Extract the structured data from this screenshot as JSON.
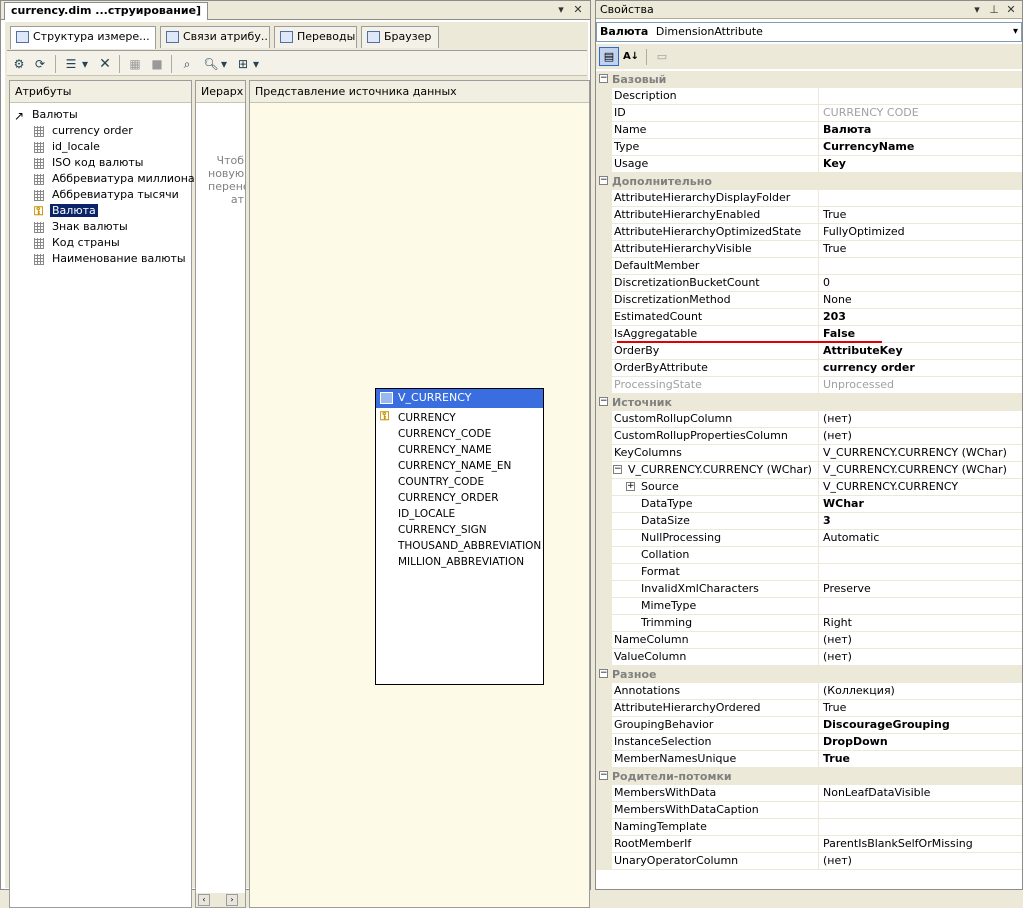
{
  "doc": {
    "tab_title": "currency.dim ...струирование]",
    "designer_tabs": [
      "Структура измере...",
      "Связи атрибу...",
      "Переводы",
      "Браузер"
    ],
    "attributes_header": "Атрибуты",
    "hierarchies_header": "Иерарх",
    "dsv_header": "Представление источника данных",
    "hier_hint": [
      "Чтоб",
      "новую",
      "перене",
      "ат"
    ],
    "tree_root": "Валюты",
    "attributes": [
      "currency order",
      "id_locale",
      "ISO код валюты",
      "Аббревиатура миллиона",
      "Аббревиатура тысячи",
      "Валюта",
      "Знак валюты",
      "Код страны",
      "Наименование валюты"
    ],
    "selected_attribute": "Валюта",
    "table": {
      "name": "V_CURRENCY",
      "columns": [
        "CURRENCY",
        "CURRENCY_CODE",
        "CURRENCY_NAME",
        "CURRENCY_NAME_EN",
        "COUNTRY_CODE",
        "CURRENCY_ORDER",
        "ID_LOCALE",
        "CURRENCY_SIGN",
        "THOUSAND_ABBREVIATION",
        "MILLION_ABBREVIATION"
      ]
    }
  },
  "props": {
    "title": "Свойства",
    "object_name": "Валюта",
    "object_type": "DimensionAttribute",
    "rows": [
      {
        "kind": "cat",
        "name": "Базовый"
      },
      {
        "name": "Description",
        "value": ""
      },
      {
        "name": "ID",
        "value": "CURRENCY CODE",
        "style": "g"
      },
      {
        "name": "Name",
        "value": "Валюта",
        "style": "b"
      },
      {
        "name": "Type",
        "value": "CurrencyName",
        "style": "b"
      },
      {
        "name": "Usage",
        "value": "Key",
        "style": "b"
      },
      {
        "kind": "cat",
        "name": "Дополнительно"
      },
      {
        "name": "AttributeHierarchyDisplayFolder",
        "value": ""
      },
      {
        "name": "AttributeHierarchyEnabled",
        "value": "True"
      },
      {
        "name": "AttributeHierarchyOptimizedState",
        "value": "FullyOptimized"
      },
      {
        "name": "AttributeHierarchyVisible",
        "value": "True"
      },
      {
        "name": "DefaultMember",
        "value": ""
      },
      {
        "name": "DiscretizationBucketCount",
        "value": "0"
      },
      {
        "name": "DiscretizationMethod",
        "value": "None"
      },
      {
        "name": "EstimatedCount",
        "value": "203",
        "style": "b"
      },
      {
        "name": "IsAggregatable",
        "value": "False",
        "style": "b"
      },
      {
        "name": "OrderBy",
        "value": "AttributeKey",
        "style": "b"
      },
      {
        "name": "OrderByAttribute",
        "value": "currency order",
        "style": "b"
      },
      {
        "name": "ProcessingState",
        "value": "Unprocessed",
        "style": "g",
        "namestyle": "g"
      },
      {
        "kind": "cat",
        "name": "Источник"
      },
      {
        "name": "CustomRollupColumn",
        "value": "(нет)"
      },
      {
        "name": "CustomRollupPropertiesColumn",
        "value": "(нет)"
      },
      {
        "name": "KeyColumns",
        "value": "V_CURRENCY.CURRENCY (WChar)",
        "expander": "minus",
        "level": 0
      },
      {
        "name": "V_CURRENCY.CURRENCY (WChar)",
        "value": "V_CURRENCY.CURRENCY (WChar)",
        "expander": "minus",
        "level": 1
      },
      {
        "name": "Source",
        "value": "V_CURRENCY.CURRENCY",
        "expander": "plus",
        "level": 2
      },
      {
        "name": "DataType",
        "value": "WChar",
        "style": "b",
        "level": 2
      },
      {
        "name": "DataSize",
        "value": "3",
        "style": "b",
        "level": 2
      },
      {
        "name": "NullProcessing",
        "value": "Automatic",
        "level": 2
      },
      {
        "name": "Collation",
        "value": "",
        "level": 2
      },
      {
        "name": "Format",
        "value": "",
        "level": 2
      },
      {
        "name": "InvalidXmlCharacters",
        "value": "Preserve",
        "level": 2
      },
      {
        "name": "MimeType",
        "value": "",
        "level": 2
      },
      {
        "name": "Trimming",
        "value": "Right",
        "level": 2
      },
      {
        "name": "NameColumn",
        "value": "(нет)"
      },
      {
        "name": "ValueColumn",
        "value": "(нет)"
      },
      {
        "kind": "cat",
        "name": "Разное"
      },
      {
        "name": "Annotations",
        "value": "(Коллекция)"
      },
      {
        "name": "AttributeHierarchyOrdered",
        "value": "True"
      },
      {
        "name": "GroupingBehavior",
        "value": "DiscourageGrouping",
        "style": "b"
      },
      {
        "name": "InstanceSelection",
        "value": "DropDown",
        "style": "b"
      },
      {
        "name": "MemberNamesUnique",
        "value": "True",
        "style": "b"
      },
      {
        "kind": "cat",
        "name": "Родители-потомки"
      },
      {
        "name": "MembersWithData",
        "value": "NonLeafDataVisible"
      },
      {
        "name": "MembersWithDataCaption",
        "value": ""
      },
      {
        "name": "NamingTemplate",
        "value": ""
      },
      {
        "name": "RootMemberIf",
        "value": "ParentIsBlankSelfOrMissing"
      },
      {
        "name": "UnaryOperatorColumn",
        "value": "(нет)"
      }
    ]
  },
  "colors": {
    "selection": "#0a246a",
    "table_header": "#3a6ee0",
    "highlight_underline": "#e00000"
  }
}
